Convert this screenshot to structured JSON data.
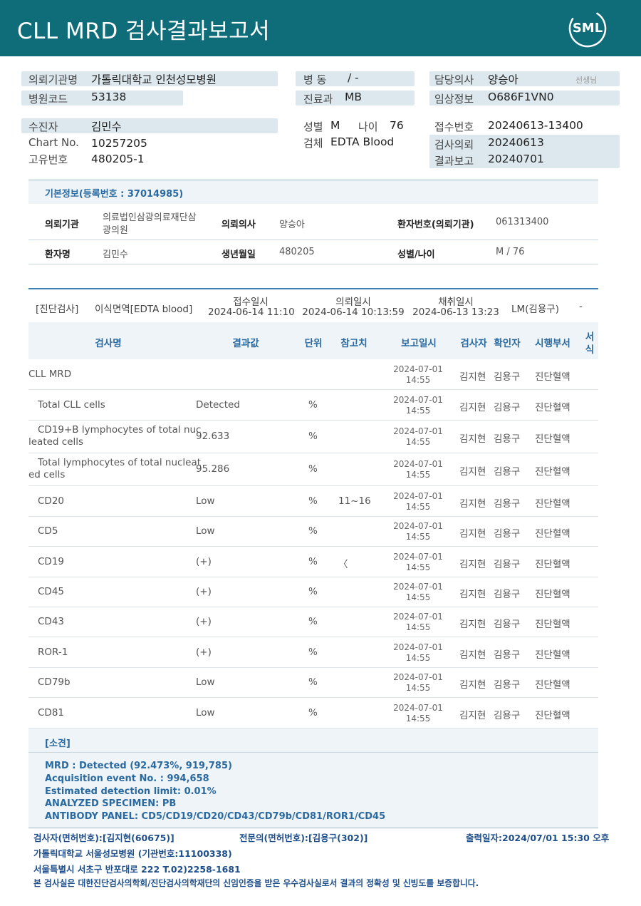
{
  "header": {
    "title": "CLL MRD 검사결과보고서",
    "logo": "SML"
  },
  "info": {
    "req_org_label": "의뢰기관명",
    "req_org_value": "가톨릭대학교 인천성모병원",
    "hosp_code_label": "병원코드",
    "hosp_code_value": "53138",
    "ward_label": "병 동",
    "ward_value": "/ -",
    "dept_label": "진료과",
    "dept_value": "MB",
    "doctor_label": "담당의사",
    "doctor_value": "양승아",
    "doctor_suffix": "선생님",
    "clinical_label": "임상정보",
    "clinical_value": "O686F1VN0",
    "patient_label": "수진자",
    "patient_value": "김민수",
    "chart_label": "Chart No.",
    "chart_value": "10257205",
    "unique_label": "고유번호",
    "unique_value": "480205-1",
    "sex_label": "성별",
    "sex_value": "M",
    "age_label": "나이",
    "age_value": "76",
    "specimen_label": "검체",
    "specimen_value": "EDTA Blood",
    "receipt_label": "접수번호",
    "receipt_value": "20240613-13400",
    "exam_req_label": "검사의뢰",
    "exam_req_value": "20240613",
    "result_label": "결과보고",
    "result_value": "20240701"
  },
  "basic": {
    "title": "기본정보(등록번호 : 37014985)",
    "org_label": "의뢰기관",
    "org_value_1": "의료법인삼광의료재단삼",
    "org_value_2": "광의원",
    "req_doc_label": "의뢰의사",
    "req_doc_value": "양승아",
    "pt_no_label": "환자번호(의뢰기관)",
    "pt_no_value": "061313400",
    "name_label": "환자명",
    "name_value": "김민수",
    "birth_label": "생년월일",
    "birth_value": "480205",
    "sexage_label": "성별/나이",
    "sexage_value": "M / 76"
  },
  "exam": {
    "category": "[진단검사]",
    "name": "이식면역[EDTA blood]",
    "recv_label": "접수일시",
    "recv_value": "2024-06-14 11:10",
    "req_label": "의뢰일시",
    "req_value": "2024-06-14 10:13:59",
    "col_label": "채취일시",
    "col_value": "2024-06-13 13:23",
    "lm": "LM(김용구)",
    "dash": "-"
  },
  "table": {
    "headers": {
      "name": "검사명",
      "result": "결과값",
      "unit": "단위",
      "ref": "참고치",
      "date": "보고일시",
      "tester": "검사자",
      "confirmer": "확인자",
      "dept": "시행부서",
      "form1": "서",
      "form2": "식"
    },
    "rows": [
      {
        "name1": "CLL MRD",
        "name2": "",
        "result": "",
        "unit": "",
        "ref": "",
        "date1": "2024-07-01",
        "date2": "14:55",
        "tester": "김지현",
        "confirmer": "김용구",
        "dept": "진단혈액"
      },
      {
        "name1": "Total CLL cells",
        "name2": "",
        "result": "Detected",
        "unit": "%",
        "ref": "",
        "date1": "2024-07-01",
        "date2": "14:55",
        "tester": "김지현",
        "confirmer": "김용구",
        "dept": "진단혈액"
      },
      {
        "name1": "CD19+B lymphocytes of total nuc",
        "name2": "leated cells",
        "result": "92.633",
        "unit": "%",
        "ref": "",
        "date1": "2024-07-01",
        "date2": "14:55",
        "tester": "김지현",
        "confirmer": "김용구",
        "dept": "진단혈액"
      },
      {
        "name1": "Total lymphocytes of total nucleat",
        "name2": "ed cells",
        "result": "95.286",
        "unit": "%",
        "ref": "",
        "date1": "2024-07-01",
        "date2": "14:55",
        "tester": "김지현",
        "confirmer": "김용구",
        "dept": "진단혈액"
      },
      {
        "name1": "CD20",
        "name2": "",
        "result": "Low",
        "unit": "%",
        "ref": "11~16",
        "date1": "2024-07-01",
        "date2": "14:55",
        "tester": "김지현",
        "confirmer": "김용구",
        "dept": "진단혈액"
      },
      {
        "name1": "CD5",
        "name2": "",
        "result": "Low",
        "unit": "%",
        "ref": "",
        "date1": "2024-07-01",
        "date2": "14:55",
        "tester": "김지현",
        "confirmer": "김용구",
        "dept": "진단혈액"
      },
      {
        "name1": "CD19",
        "name2": "",
        "result": "(+)",
        "unit": "%",
        "ref": "〈",
        "date1": "2024-07-01",
        "date2": "14:55",
        "tester": "김지현",
        "confirmer": "김용구",
        "dept": "진단혈액"
      },
      {
        "name1": "CD45",
        "name2": "",
        "result": "(+)",
        "unit": "%",
        "ref": "",
        "date1": "2024-07-01",
        "date2": "14:55",
        "tester": "김지현",
        "confirmer": "김용구",
        "dept": "진단혈액"
      },
      {
        "name1": "CD43",
        "name2": "",
        "result": "(+)",
        "unit": "%",
        "ref": "",
        "date1": "2024-07-01",
        "date2": "14:55",
        "tester": "김지현",
        "confirmer": "김용구",
        "dept": "진단혈액"
      },
      {
        "name1": "ROR-1",
        "name2": "",
        "result": "(+)",
        "unit": "%",
        "ref": "",
        "date1": "2024-07-01",
        "date2": "14:55",
        "tester": "김지현",
        "confirmer": "김용구",
        "dept": "진단혈액"
      },
      {
        "name1": "CD79b",
        "name2": "",
        "result": "Low",
        "unit": "%",
        "ref": "",
        "date1": "2024-07-01",
        "date2": "14:55",
        "tester": "김지현",
        "confirmer": "김용구",
        "dept": "진단혈액"
      },
      {
        "name1": "CD81",
        "name2": "",
        "result": "Low",
        "unit": "%",
        "ref": "",
        "date1": "2024-07-01",
        "date2": "14:55",
        "tester": "김지현",
        "confirmer": "김용구",
        "dept": "진단혈액"
      }
    ]
  },
  "remarks": {
    "title": "[소견]",
    "lines": [
      "MRD : Detected (92.473%, 919,785)",
      "Acquisition event No. : 994,658",
      "Estimated detection limit: 0.01%",
      "ANALYZED SPECIMEN: PB",
      "ANTIBODY PANEL: CD5/CD19/CD20/CD43/CD79b/CD81/ROR1/CD45"
    ]
  },
  "footer": {
    "tester": "검사자(면허번호):[김지현(60675)]",
    "specialist": "전문의(면허번호):[김용구(302)]",
    "printed": "출력일자:2024/07/01 15:30 오후",
    "hospital": "가톨릭대학교 서울성모병원 (기관번호:11100338)",
    "address": "서울특별시 서초구 반포대로 222 T.02)2258-1681",
    "cert": "본 검사실은 대한진단검사의학회/진단검사의학재단의 신임인증을 받은 우수검사실로서 결과의 정확성 및 신빙도를 보증합니다."
  }
}
